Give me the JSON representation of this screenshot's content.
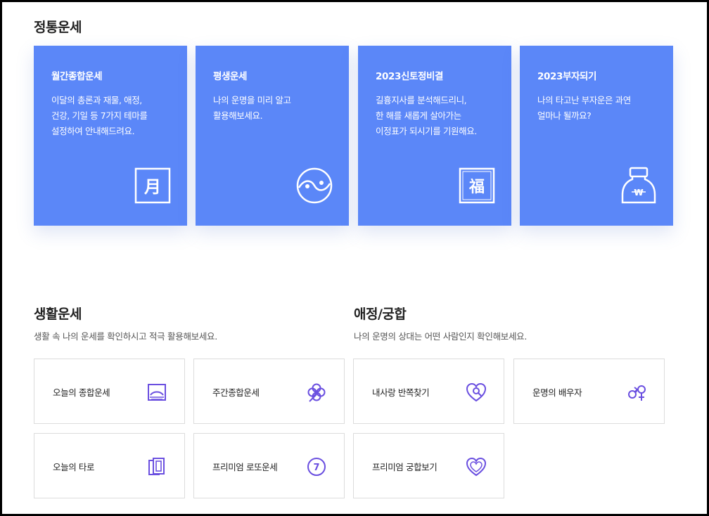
{
  "main_section": {
    "title": "정통운세"
  },
  "cards": [
    {
      "title": "월간종합운세",
      "desc_lines": [
        "이달의 총론과 재물, 애정,",
        "건강, 기일 등 7가지 테마를",
        "설정하여 안내해드려요."
      ],
      "icon": "moon-month-icon",
      "icon_char": "月"
    },
    {
      "title": "평생운세",
      "desc_lines": [
        "나의 운명을 미리 알고",
        "활용해보세요."
      ],
      "icon": "yin-yang-icon"
    },
    {
      "title": "2023신토정비결",
      "desc_lines": [
        "길흉지사를 분석해드리니,",
        "한 해를 새롭게 살아가는",
        "이정표가 되시기를 기원해요."
      ],
      "icon": "fortune-bok-icon",
      "icon_char": "福"
    },
    {
      "title": "2023부자되기",
      "desc_lines": [
        "나의 타고난 부자운은 과연",
        "얼마나 될까요?"
      ],
      "icon": "money-pouch-icon",
      "icon_char": "₩"
    }
  ],
  "life_section": {
    "title": "생활운세",
    "desc": "생활 속 나의 운세를 확인하시고 적극 활용해보세요.",
    "items": [
      {
        "label": "오늘의 종합운세",
        "icon": "sunrise-frame-icon"
      },
      {
        "label": "주간종합운세",
        "icon": "clover-icon"
      },
      {
        "label": "오늘의 타로",
        "icon": "tarot-cards-icon"
      },
      {
        "label": "프리미엄 로또운세",
        "icon": "lotto-seven-icon",
        "icon_char": "7"
      }
    ]
  },
  "love_section": {
    "title": "애정/궁합",
    "desc": "나의 운명의 상대는 어떤 사람인지 확인해보세요.",
    "items": [
      {
        "label": "내사랑 반쪽찾기",
        "icon": "heart-search-icon"
      },
      {
        "label": "운명의 배우자",
        "icon": "gender-symbols-icon"
      },
      {
        "label": "프리미엄 궁합보기",
        "icon": "heart-outline-icon"
      }
    ]
  },
  "colors": {
    "card_bg": "#5b87f8",
    "icon_purple": "#6a4fe0",
    "border": "#dcdcdc"
  }
}
